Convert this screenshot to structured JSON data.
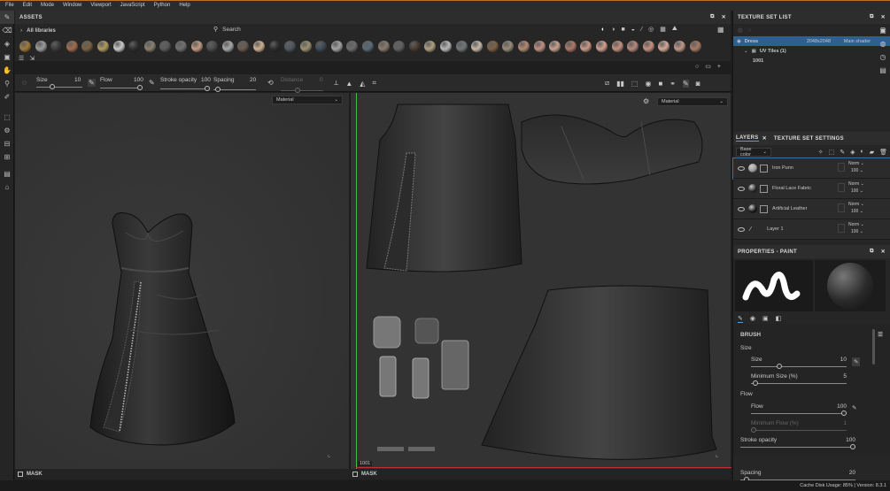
{
  "menu": [
    "File",
    "Edit",
    "Mode",
    "Window",
    "Viewport",
    "JavaScript",
    "Python",
    "Help"
  ],
  "assets": {
    "title": "ASSETS",
    "library": "All libraries",
    "search_placeholder": "Search",
    "materials": [
      "#a07a3a",
      "#9a9a9a",
      "#3a3a3a",
      "#a26b4c",
      "#7a6040",
      "#b29a60",
      "#c8c8c8",
      "#303030",
      "#8a8070",
      "#5a5a5a",
      "#707070",
      "#c29a80",
      "#4a4a4a",
      "#a8a8a8",
      "#6a5a50",
      "#d0b090",
      "#2e2e2e",
      "#505860",
      "#9b9070",
      "#3e4a55",
      "#a4a4a4",
      "#6c6c6c",
      "#5a6a78",
      "#8a7a6a",
      "#606060",
      "#4a3a30",
      "#b0a080",
      "#b8b8b8",
      "#707878",
      "#c4b8a8",
      "#806040",
      "#9a8a7a",
      "#b48a70",
      "#c09080",
      "#c8a090",
      "#b07868",
      "#c89a88",
      "#d0a090",
      "#c49080",
      "#b8887a",
      "#c89080",
      "#d4a898",
      "#c09888",
      "#a87a66"
    ]
  },
  "brush_bar": {
    "size_label": "Size",
    "size_value": "10",
    "flow_label": "Flow",
    "flow_value": "100",
    "stroke_label": "Stroke opacity",
    "stroke_value": "100",
    "spacing_label": "Spacing",
    "spacing_value": "20",
    "distance_label": "Distance",
    "distance_value": "0"
  },
  "viewport3d": {
    "material_select": "Material",
    "mask_label": "MASK"
  },
  "viewport2d": {
    "material_select": "Material",
    "mask_label": "MASK",
    "uv_tile": "1001"
  },
  "texture_set": {
    "title": "TEXTURE SET LIST",
    "name": "Dress",
    "resolution": "2048x2048",
    "shader": "Main shader",
    "uv_tiles": "UV Tiles (1)",
    "tile": "1001"
  },
  "layers": {
    "tab_layers": "LAYERS",
    "tab_settings": "TEXTURE SET SETTINGS",
    "channel": "Base color",
    "items": [
      {
        "name": "Iron Punn",
        "blend": "Norm",
        "opacity": "100",
        "thumb": "#9a9a9a"
      },
      {
        "name": "Floral Lace Fabric",
        "blend": "Norm",
        "opacity": "100",
        "thumb": "#2a2a2a"
      },
      {
        "name": "Artificial Leather",
        "blend": "Norm",
        "opacity": "100",
        "thumb": "#1a1a1a"
      },
      {
        "name": "Layer 1",
        "blend": "Norm",
        "opacity": "100",
        "thumb": ""
      }
    ]
  },
  "properties": {
    "title": "PROPERTIES - PAINT",
    "brush_section": "BRUSH",
    "size_group": "Size",
    "size": {
      "label": "Size",
      "value": "10",
      "fraction": 0.3
    },
    "min_size": {
      "label": "Minimum Size (%)",
      "value": "5",
      "fraction": 0.05
    },
    "flow_group": "Flow",
    "flow": {
      "label": "Flow",
      "value": "100",
      "fraction": 1.0
    },
    "min_flow": {
      "label": "Minimum Flow (%)",
      "value": "1",
      "fraction": 0.01
    },
    "stroke": {
      "label": "Stroke opacity",
      "value": "100",
      "fraction": 1.0
    },
    "spacing": {
      "label": "Spacing",
      "value": "20",
      "fraction": 0.05
    }
  },
  "status": "Cache Disk Usage:  85% | Version: 8.3.1",
  "colors": {
    "accent": "#b9722c",
    "selected_row": "#2e5f8f"
  }
}
